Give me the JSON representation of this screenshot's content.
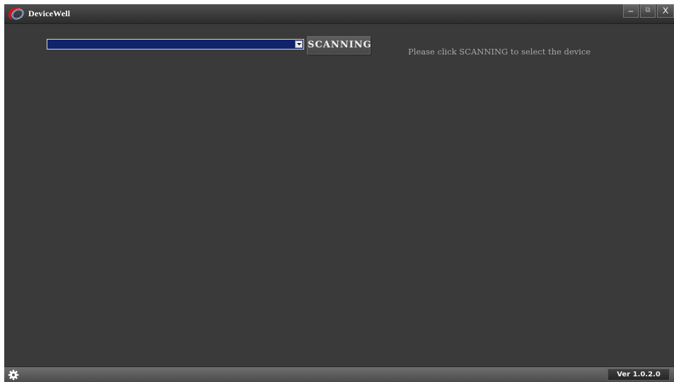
{
  "window": {
    "title": "DeviceWell",
    "controls": {
      "minimize_label": "–",
      "maximize_label": "⧉",
      "close_label": "X"
    }
  },
  "device": {
    "selected_value": "",
    "scan_button_label": "SCANNING",
    "hint": "Please click SCANNING to select the device"
  },
  "status_bar": {
    "version": "Ver 1.0.2.0"
  },
  "colors": {
    "background": "#3a3a3a",
    "select_fill": "#10236b",
    "logo_red": "#c8171e",
    "logo_blue": "#2b4fa8"
  },
  "icons": {
    "app_logo": "devicewell-logo",
    "settings": "gear-icon",
    "select_arrow": "chevron-down-icon"
  }
}
